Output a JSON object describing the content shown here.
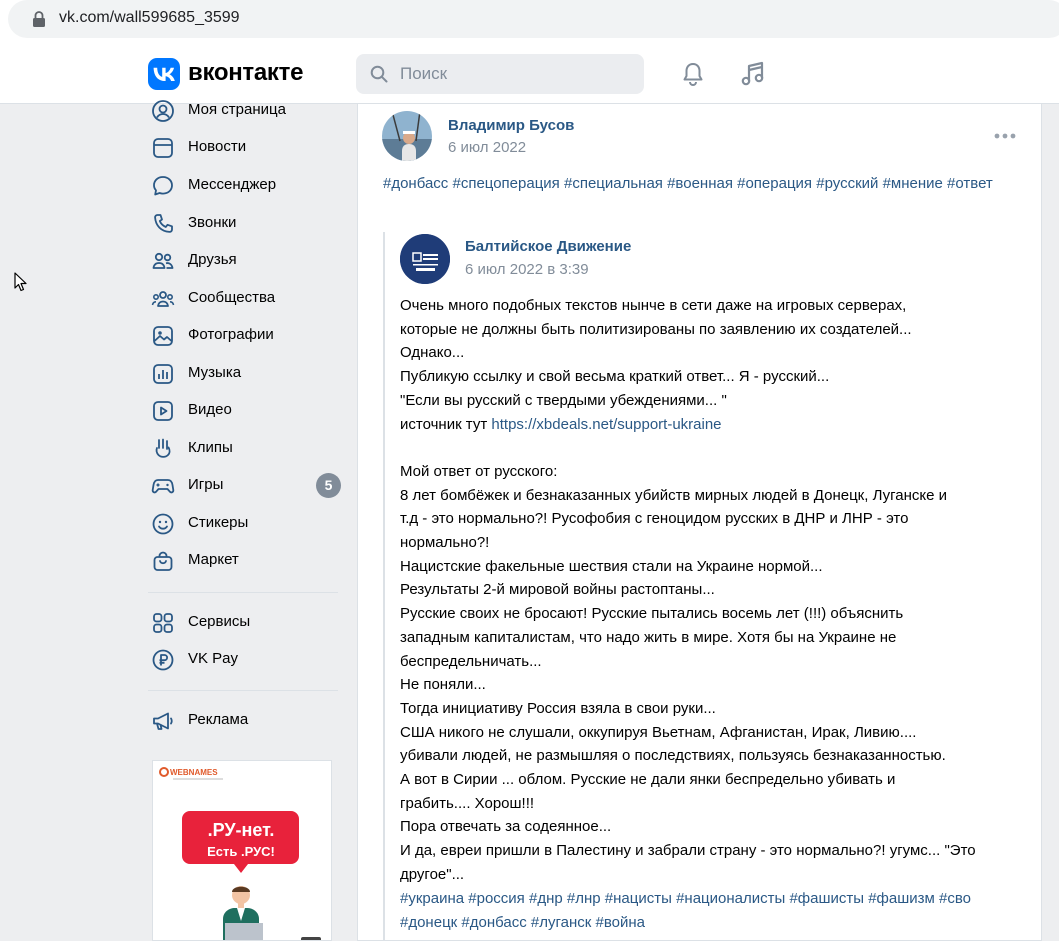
{
  "browser": {
    "url": "vk.com/wall599685_3599"
  },
  "header": {
    "brand": "вконтакте",
    "search_placeholder": "Поиск"
  },
  "sidebar": {
    "items": [
      {
        "label": "Моя страница",
        "icon": "user-icon"
      },
      {
        "label": "Новости",
        "icon": "news-icon"
      },
      {
        "label": "Мессенджер",
        "icon": "messenger-icon"
      },
      {
        "label": "Звонки",
        "icon": "phone-icon"
      },
      {
        "label": "Друзья",
        "icon": "friends-icon"
      },
      {
        "label": "Сообщества",
        "icon": "communities-icon"
      },
      {
        "label": "Фотографии",
        "icon": "photos-icon"
      },
      {
        "label": "Музыка",
        "icon": "music-icon"
      },
      {
        "label": "Видео",
        "icon": "video-icon"
      },
      {
        "label": "Клипы",
        "icon": "clips-icon"
      },
      {
        "label": "Игры",
        "icon": "games-icon",
        "badge": "5"
      },
      {
        "label": "Стикеры",
        "icon": "stickers-icon"
      },
      {
        "label": "Маркет",
        "icon": "market-icon"
      }
    ],
    "services": [
      {
        "label": "Сервисы",
        "icon": "services-icon"
      },
      {
        "label": "VK Pay",
        "icon": "vkpay-icon"
      }
    ],
    "ads_label": "Реклама",
    "ad": {
      "brand": "WEBNAMES",
      "headline1": ".РУ-нет.",
      "headline2": "Есть .РУС!"
    }
  },
  "post": {
    "author": "Владимир Бусов",
    "date": "6 июл 2022",
    "hashtags": [
      "#донбасс",
      "#спецоперация",
      "#специальная",
      "#военная",
      "#операция",
      "#русский",
      "#мнение",
      "#ответ"
    ],
    "repost": {
      "author": "Балтийское Движение",
      "date": "6 июл 2022 в 3:39",
      "text_before_link": "Очень много подобных текстов нынче в сети даже на игровых серверах,\nкоторые не должны быть политизированы по заявлению их создателей...\nОднако...\nПубликую ссылку и свой весьма краткий ответ... Я - русский...\n\"Если вы русский с твердыми убеждениями... \"\nисточник тут ",
      "link": "https://xbdeals.net/support-ukraine",
      "text_after_link": "\n\nМой ответ от русского:\n8 лет бомбёжек и безнаказанных убийств мирных людей в Донецк, Луганске и\nт.д - это нормально?! Русофобия с геноцидом русских в ДНР и ЛНР - это\nнормально?!\nНацистские факельные шествия стали на Украине нормой...\nРезультаты 2-й мировой войны растоптаны...\nРусские своих не бросают! Русские пытались восемь лет (!!!) объяснить\nзападным капиталистам, что надо жить в мире. Хотя бы на Украине не\nбеспредельничать...\nНе поняли...\nТогда инициативу Россия взяла в свои руки...\nСША никого не слушали, оккупируя Вьетнам, Афганистан, Ирак, Ливию....\nубивали людей, не размышляя о последствиях, пользуясь безнаказанностью.\nА вот в Сирии ... облом. Русские не дали янки беспредельно убивать и\nграбить.... Хорош!!!\nПора отвечать за содеянное...\nИ да, евреи пришли в Палестину и забрали страну - это нормально?! угумс... \"Это\nдругое\"...",
      "hashtags": [
        "#украина",
        "#россия",
        "#днр",
        "#лнр",
        "#нацисты",
        "#националисты",
        "#фашисты",
        "#фашизм",
        "#сво",
        "#донецк",
        "#донбасс",
        "#луганск",
        "#война"
      ]
    }
  },
  "colors": {
    "accent": "#2a5885",
    "vk_blue": "#0077ff",
    "secondary_text": "#818c99",
    "page_bg": "#edeef0"
  }
}
